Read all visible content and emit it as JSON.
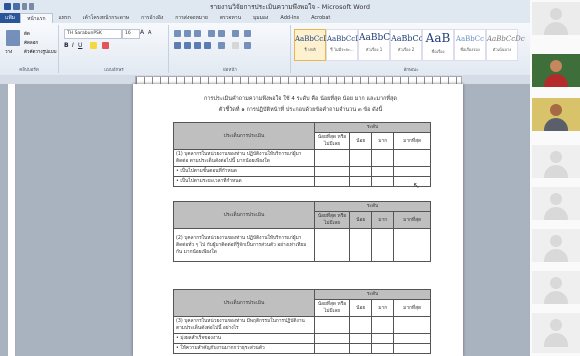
{
  "window": {
    "title": "รายงานวิจัยการประเมินความพึงพอใจ - Microsoft Word"
  },
  "menu": {
    "file": "แฟ้ม",
    "tabs": [
      "หน้าแรก",
      "แทรก",
      "เค้าโครงหน้ากระดาษ",
      "การอ้างอิง",
      "การส่งจดหมาย",
      "ตรวจทาน",
      "มุมมอง",
      "Add-Ins",
      "Acrobat"
    ]
  },
  "ribbon": {
    "clipboard_label": "คลิปบอร์ด",
    "paste_label": "วาง",
    "cut_label": "ตัด",
    "copy_label": "คัดลอก",
    "format_painter_label": "ตัวคัดวางรูปแบบ",
    "font_label": "แบบอักษร",
    "font_name": "TH SarabunPSK",
    "font_size": "16",
    "paragraph_label": "ย่อหน้า",
    "styles_label": "ลักษณะ",
    "styles": [
      {
        "preview": "AaBbCcDc",
        "name": "¶ ปกติ"
      },
      {
        "preview": "AaBbCcDc",
        "name": "¶ ไม่มีระยะ..."
      },
      {
        "preview": "AaBbC",
        "name": "หัวเรื่อง 1"
      },
      {
        "preview": "AaBbCc",
        "name": "หัวเรื่อง 2"
      },
      {
        "preview": "AaB",
        "name": "ชื่อเรื่อง"
      },
      {
        "preview": "AaBbCc",
        "name": "ชื่อเรื่องรอง"
      },
      {
        "preview": "AaBbCcDc",
        "name": "ตัวเน้นบาง"
      }
    ]
  },
  "document": {
    "heading_line1": "การประเมินคำถามความพึงพอใจ ใช้ 4 ระดับ คือ น้อยที่สุด น้อย มาก และมากที่สุด",
    "heading_line2": "ตัวชี้วัดที่ ๑ การปฏิบัติหน้าที่ ประกอบด้วยข้อคำถามจำนวน ๓ ข้อ ดังนี้",
    "col_topic": "ประเด็นการประเมิน",
    "col_level": "ระดับ",
    "col_least": "น้อยที่สุด หรือไม่มีเลย",
    "col_low": "น้อย",
    "col_high": "มาก",
    "col_most": "มากที่สุด",
    "q1": "(1) บุคลากรในหน่วยงานของท่าน ปฏิบัติงานให้บริการแก่ผู้มาติดต่อ ตามประเด็นดังต่อไปนี้ มากน้อยเพียงใด",
    "q1_opt1": "• เป็นไปตามขั้นตอนที่กำหนด",
    "q1_opt2": "• เป็นไปตามระยะเวลาที่กำหนด",
    "q2": "(2) บุคลากรในหน่วยงานของท่าน ปฏิบัติงานให้บริการแก่ผู้มาติดต่อทั่ว ๆ ไป กับผู้มาติดต่อที่รู้จักเป็นการส่วนตัว อย่างเท่าเทียมกัน มากน้อยเพียงใด",
    "q3": "(3) บุคลากรในหน่วยงานของท่าน มีพฤติกรรมในการปฏิบัติงาน ตามประเด็นดังต่อไปนี้ อย่างไร",
    "q3_opt1": "• มุ่งผลสำเร็จของงาน",
    "q3_opt2": "• ให้ความสำคัญกับงานมากกว่าธุระส่วนตัว"
  },
  "video_tiles": [
    {
      "kind": "self"
    },
    {
      "kind": "person"
    },
    {
      "kind": "person"
    },
    {
      "kind": "avatar"
    },
    {
      "kind": "avatar"
    },
    {
      "kind": "avatar"
    },
    {
      "kind": "avatar"
    },
    {
      "kind": "avatar"
    }
  ]
}
